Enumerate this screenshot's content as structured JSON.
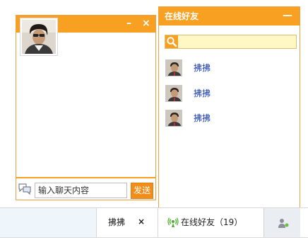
{
  "chat_window": {
    "minimize_label": "–",
    "close_label": "×",
    "input_placeholder": "输入聊天内容",
    "send_label": "发送"
  },
  "friends_panel": {
    "title": "在线好友",
    "minimize_label": "—",
    "search_value": "",
    "friends": [
      {
        "name": "拂拂"
      },
      {
        "name": "拂拂"
      },
      {
        "name": "拂拂"
      }
    ]
  },
  "bottom_bar": {
    "chat_tab_name": "拂拂",
    "chat_tab_close": "×",
    "online_label": "在线好友（19）"
  },
  "colors": {
    "accent": "#f7a021",
    "send_button": "#f28d18",
    "friend_name": "#1a3dc4",
    "search_bg": "#fff8c5"
  },
  "icons": [
    "avatar-photo",
    "chat-bubbles-icon",
    "search-icon",
    "online-signal-icon",
    "user-status-icon"
  ]
}
